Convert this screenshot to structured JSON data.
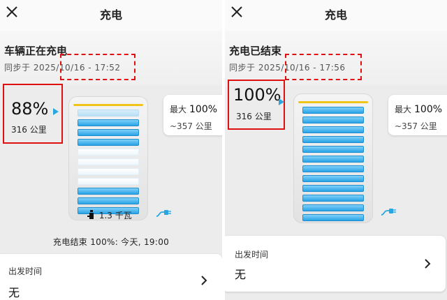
{
  "left": {
    "title": "充电",
    "status": "车辆正在充电",
    "sync_text": "同步于 2025/10/16 - 17:52",
    "percent": "88%",
    "range": "316 公里",
    "max_label": "最大",
    "max_value": "100%",
    "max_range": "~357 公里",
    "power": "1.3 千瓦",
    "finish": "充电结束 100%:  今天,  19:00",
    "depart_label": "出发时间",
    "depart_value": "无",
    "charge_level": 0.88
  },
  "right": {
    "title": "充电",
    "status": "充电已结束",
    "sync_text": "同步于 2025/10/16 - 17:56",
    "percent": "100%",
    "range": "316 公里",
    "max_label": "最大",
    "max_value": "100%",
    "max_range": "~357 公里",
    "depart_label": "出发时间",
    "depart_value": "无",
    "charge_level": 1.0
  },
  "colors": {
    "annotation_red": "#e01010",
    "cell_blue": "#2aa3e6",
    "battery_top": "#f0c419"
  },
  "icons": [
    "close-icon",
    "pointer-arrow-icon",
    "plug-icon",
    "chevron-right-icon",
    "charger-icon"
  ]
}
